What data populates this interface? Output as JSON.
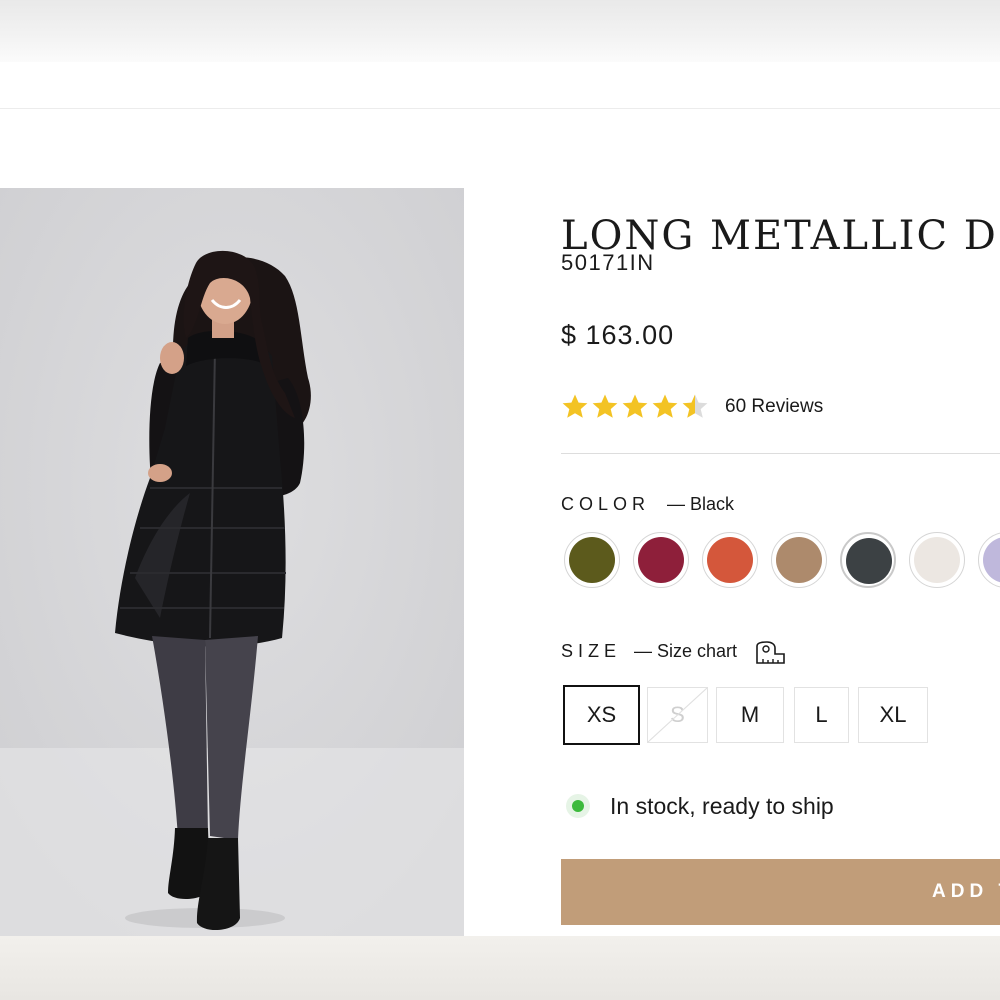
{
  "product": {
    "title": "LONG METALLIC DO",
    "sku": "50171IN",
    "price": "$ 163.00",
    "rating_value": 4.5,
    "rating_max": 5,
    "reviews_label": "60 Reviews"
  },
  "color_option": {
    "label": "COLOR",
    "selected_label": "— Black",
    "swatches": [
      {
        "color": "#5c5a1c"
      },
      {
        "color": "#8e1f3a"
      },
      {
        "color": "#d4573b"
      },
      {
        "color": "#ad8a6c"
      },
      {
        "color": "#3c4144",
        "selected": true
      },
      {
        "color": "#ece7e2"
      },
      {
        "color": "#bfb8dc"
      }
    ]
  },
  "size_option": {
    "label": "SIZE",
    "chart_label": "— Size chart",
    "sizes": [
      {
        "label": "XS",
        "state": "selected"
      },
      {
        "label": "S",
        "state": "unavailable"
      },
      {
        "label": "M",
        "state": "available"
      },
      {
        "label": "L",
        "state": "available"
      },
      {
        "label": "XL",
        "state": "available"
      }
    ]
  },
  "stock": {
    "text": "In stock, ready to ship",
    "status_color": "#3cba3c"
  },
  "cart": {
    "add_label": "ADD T"
  },
  "colors": {
    "accent": "#c19d79",
    "star": "#f3c324",
    "star_empty": "#dcdcdc"
  },
  "icons": {
    "star": "star-icon",
    "size_chart": "ruler-icon",
    "stock": "status-dot-icon"
  }
}
